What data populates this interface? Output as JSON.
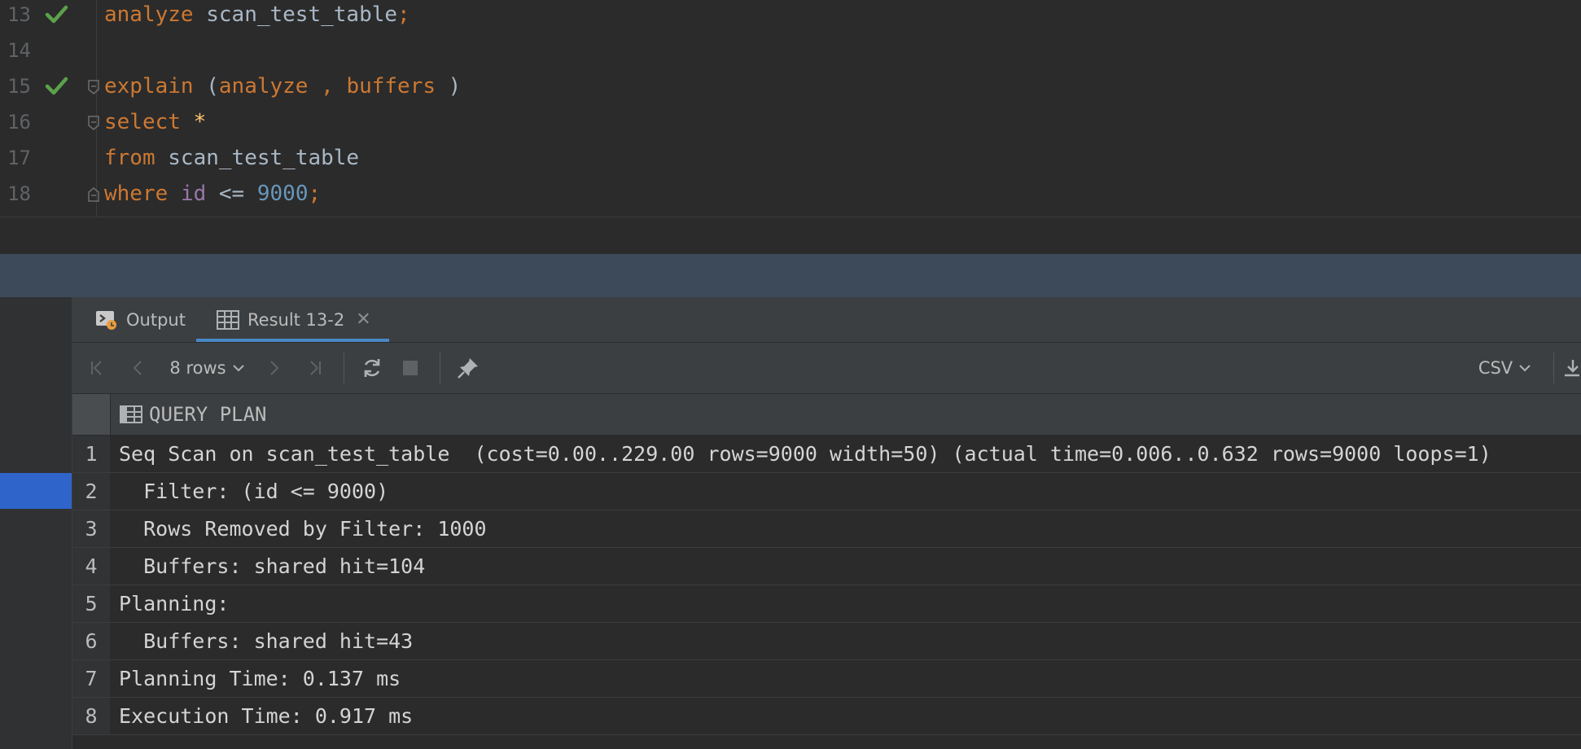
{
  "editor": {
    "lines": [
      {
        "num": "13",
        "check": true
      },
      {
        "num": "14",
        "check": false
      },
      {
        "num": "15",
        "check": true
      },
      {
        "num": "16",
        "check": false
      },
      {
        "num": "17",
        "check": false
      },
      {
        "num": "18",
        "check": false
      }
    ],
    "l13": {
      "kw": "analyze",
      "ident": "scan_test_table",
      "semi": ";"
    },
    "l15": {
      "kw": "explain",
      "open": "(",
      "opt1": "analyze",
      "comma": ",",
      "opt2": "buffers",
      "close": ")"
    },
    "l16": {
      "kw": "select",
      "star": "*"
    },
    "l17": {
      "kw": "from",
      "ident": "scan_test_table"
    },
    "l18": {
      "kw": "where",
      "col": "id",
      "op": "<=",
      "num": "9000",
      "semi": ";"
    }
  },
  "tabs": {
    "output_label": "Output",
    "result_label": "Result 13-2",
    "close_glyph": "✕"
  },
  "toolbar": {
    "rows_label": "8 rows",
    "csv_label": "CSV"
  },
  "grid": {
    "column_header": "QUERY PLAN",
    "rows": [
      {
        "num": "1",
        "value": "Seq Scan on scan_test_table  (cost=0.00..229.00 rows=9000 width=50) (actual time=0.006..0.632 rows=9000 loops=1)"
      },
      {
        "num": "2",
        "value": "  Filter: (id <= 9000)"
      },
      {
        "num": "3",
        "value": "  Rows Removed by Filter: 1000"
      },
      {
        "num": "4",
        "value": "  Buffers: shared hit=104"
      },
      {
        "num": "5",
        "value": "Planning:"
      },
      {
        "num": "6",
        "value": "  Buffers: shared hit=43"
      },
      {
        "num": "7",
        "value": "Planning Time: 0.137 ms"
      },
      {
        "num": "8",
        "value": "Execution Time: 0.917 ms"
      }
    ]
  },
  "colors": {
    "keyword": "#cc7832",
    "identifier": "#a9b7c6",
    "column": "#9876aa",
    "number": "#6897bb",
    "check": "#5ba14a",
    "selection": "#2f65ca",
    "divider": "#3d4a5a"
  }
}
